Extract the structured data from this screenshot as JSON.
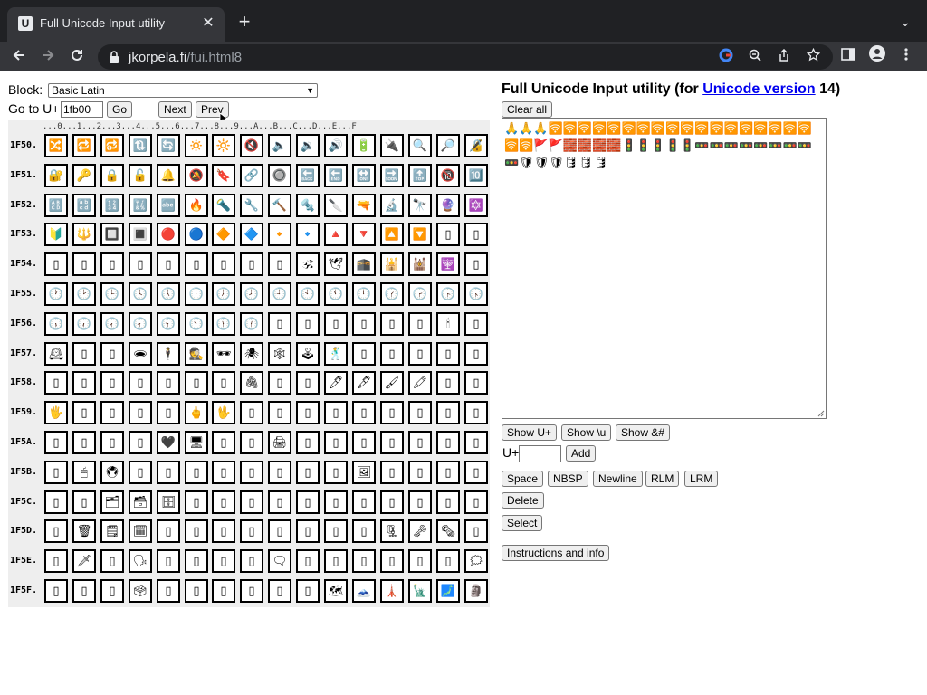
{
  "browser": {
    "tab_title": "Full Unicode Input utility",
    "tab_favicon": "U",
    "tab_close_glyph": "✕",
    "new_tab_glyph": "+",
    "tab_menu_glyph": "⌄",
    "url_host": "jkorpela.fi",
    "url_path": "/fui.html8",
    "icons": [
      "back-icon",
      "forward-icon",
      "reload-icon",
      "lock-icon",
      "google-lens-icon",
      "zoom-icon",
      "share-icon",
      "bookmark-star-icon",
      "side-panel-icon",
      "profile-icon",
      "menu-icon"
    ]
  },
  "controls": {
    "block_label": "Block:",
    "block_value": "Basic Latin",
    "goto_label": "Go to U+",
    "goto_value": "1fb00",
    "go_label": "Go",
    "next_label": "Next",
    "prev_label": "Prev"
  },
  "grid": {
    "column_header": "...0...1...2...3...4...5...6...7...8...9...A...B...C...D...E...F",
    "rows": [
      {
        "label": "1F50.",
        "cells": [
          "🔀",
          "🔁",
          "🔂",
          "🔃",
          "🔄",
          "🔅",
          "🔆",
          "🔇",
          "🔈",
          "🔉",
          "🔊",
          "🔋",
          "🔌",
          "🔍",
          "🔎",
          "🔏"
        ]
      },
      {
        "label": "1F51.",
        "cells": [
          "🔐",
          "🔑",
          "🔒",
          "🔓",
          "🔔",
          "🔕",
          "🔖",
          "🔗",
          "🔘",
          "🔙",
          "🔚",
          "🔛",
          "🔜",
          "🔝",
          "🔞",
          "🔟"
        ]
      },
      {
        "label": "1F52.",
        "cells": [
          "🔠",
          "🔡",
          "🔢",
          "🔣",
          "🔤",
          "🔥",
          "🔦",
          "🔧",
          "🔨",
          "🔩",
          "🔪",
          "🔫",
          "🔬",
          "🔭",
          "🔮",
          "🔯"
        ]
      },
      {
        "label": "1F53.",
        "cells": [
          "🔰",
          "🔱",
          "🔲",
          "🔳",
          "🔴",
          "🔵",
          "🔶",
          "🔷",
          "🔸",
          "🔹",
          "🔺",
          "🔻",
          "🔼",
          "🔽",
          "▯",
          "▯"
        ]
      },
      {
        "label": "1F54.",
        "cells": [
          "▯",
          "▯",
          "▯",
          "▯",
          "▯",
          "▯",
          "▯",
          "▯",
          "▯",
          "🕉",
          "🕊",
          "🕋",
          "🕌",
          "🕍",
          "🕎",
          "▯"
        ]
      },
      {
        "label": "1F55.",
        "cells": [
          "🕐",
          "🕑",
          "🕒",
          "🕓",
          "🕔",
          "🕕",
          "🕖",
          "🕗",
          "🕘",
          "🕙",
          "🕚",
          "🕛",
          "🕜",
          "🕝",
          "🕞",
          "🕟"
        ]
      },
      {
        "label": "1F56.",
        "cells": [
          "🕠",
          "🕡",
          "🕢",
          "🕣",
          "🕤",
          "🕥",
          "🕦",
          "🕧",
          "▯",
          "▯",
          "▯",
          "▯",
          "▯",
          "▯",
          "🕯",
          "▯"
        ]
      },
      {
        "label": "1F57.",
        "cells": [
          "🕰",
          "▯",
          "▯",
          "🕳",
          "🕴",
          "🕵",
          "🕶",
          "🕷",
          "🕸",
          "🕹",
          "🕺",
          "▯",
          "▯",
          "▯",
          "▯",
          "▯"
        ]
      },
      {
        "label": "1F58.",
        "cells": [
          "▯",
          "▯",
          "▯",
          "▯",
          "▯",
          "▯",
          "▯",
          "🖇",
          "▯",
          "▯",
          "🖊",
          "🖋",
          "🖌",
          "🖍",
          "▯",
          "▯"
        ]
      },
      {
        "label": "1F59.",
        "cells": [
          "🖐",
          "▯",
          "▯",
          "▯",
          "▯",
          "🖕",
          "🖖",
          "▯",
          "▯",
          "▯",
          "▯",
          "▯",
          "▯",
          "▯",
          "▯",
          "▯"
        ]
      },
      {
        "label": "1F5A.",
        "cells": [
          "▯",
          "▯",
          "▯",
          "▯",
          "🖤",
          "🖥",
          "▯",
          "▯",
          "🖨",
          "▯",
          "▯",
          "▯",
          "▯",
          "▯",
          "▯",
          "▯"
        ]
      },
      {
        "label": "1F5B.",
        "cells": [
          "▯",
          "🖱",
          "🖲",
          "▯",
          "▯",
          "▯",
          "▯",
          "▯",
          "▯",
          "▯",
          "▯",
          "🖼",
          "▯",
          "▯",
          "▯",
          "▯"
        ]
      },
      {
        "label": "1F5C.",
        "cells": [
          "▯",
          "▯",
          "🗂",
          "🗃",
          "🗄",
          "▯",
          "▯",
          "▯",
          "▯",
          "▯",
          "▯",
          "▯",
          "▯",
          "▯",
          "▯",
          "▯"
        ]
      },
      {
        "label": "1F5D.",
        "cells": [
          "▯",
          "🗑",
          "🗒",
          "🗓",
          "▯",
          "▯",
          "▯",
          "▯",
          "▯",
          "▯",
          "▯",
          "▯",
          "🗜",
          "🗝",
          "🗞",
          "▯"
        ]
      },
      {
        "label": "1F5E.",
        "cells": [
          "▯",
          "🗡",
          "▯",
          "🗣",
          "▯",
          "▯",
          "▯",
          "▯",
          "🗨",
          "▯",
          "▯",
          "▯",
          "▯",
          "▯",
          "▯",
          "🗯"
        ]
      },
      {
        "label": "1F5F.",
        "cells": [
          "▯",
          "▯",
          "▯",
          "🗳",
          "▯",
          "▯",
          "▯",
          "▯",
          "▯",
          "▯",
          "🗺",
          "🗻",
          "🗼",
          "🗽",
          "🗾",
          "🗿"
        ]
      }
    ]
  },
  "panel": {
    "title_prefix": "Full Unicode Input utility (for ",
    "title_link": "Unicode version",
    "title_suffix": " 14)",
    "clear_label": "Clear all",
    "output_text": "🙏🙏🙏🛜🛜🛜🛜🛜🛜🛜🛜🛜🛜🛜🛜🛜🛜🛜🛜🛜🛜🛜🛜🚩🚩🧱🧱🧱🧱🚦🚦🚦🚦🚦🚥🚥🚥🚥🚥🚥🚥🚥🚥🛡🛡🛡🛢🛢🛢",
    "show_u_label": "Show U+",
    "show_bs_label": "Show \\u",
    "show_amp_label": "Show &#",
    "uplus_label": "U+",
    "add_label": "Add",
    "space_label": "Space",
    "nbsp_label": "NBSP",
    "newline_label": "Newline",
    "rlm_label": "RLM",
    "lrm_label": "LRM",
    "delete_label": "Delete",
    "select_label": "Select",
    "instructions_label": "Instructions and info"
  },
  "colors": {
    "chrome_dark": "#202124",
    "chrome_mid": "#35363a",
    "grid_bg": "#eeeeee",
    "link": "#0000ee"
  }
}
